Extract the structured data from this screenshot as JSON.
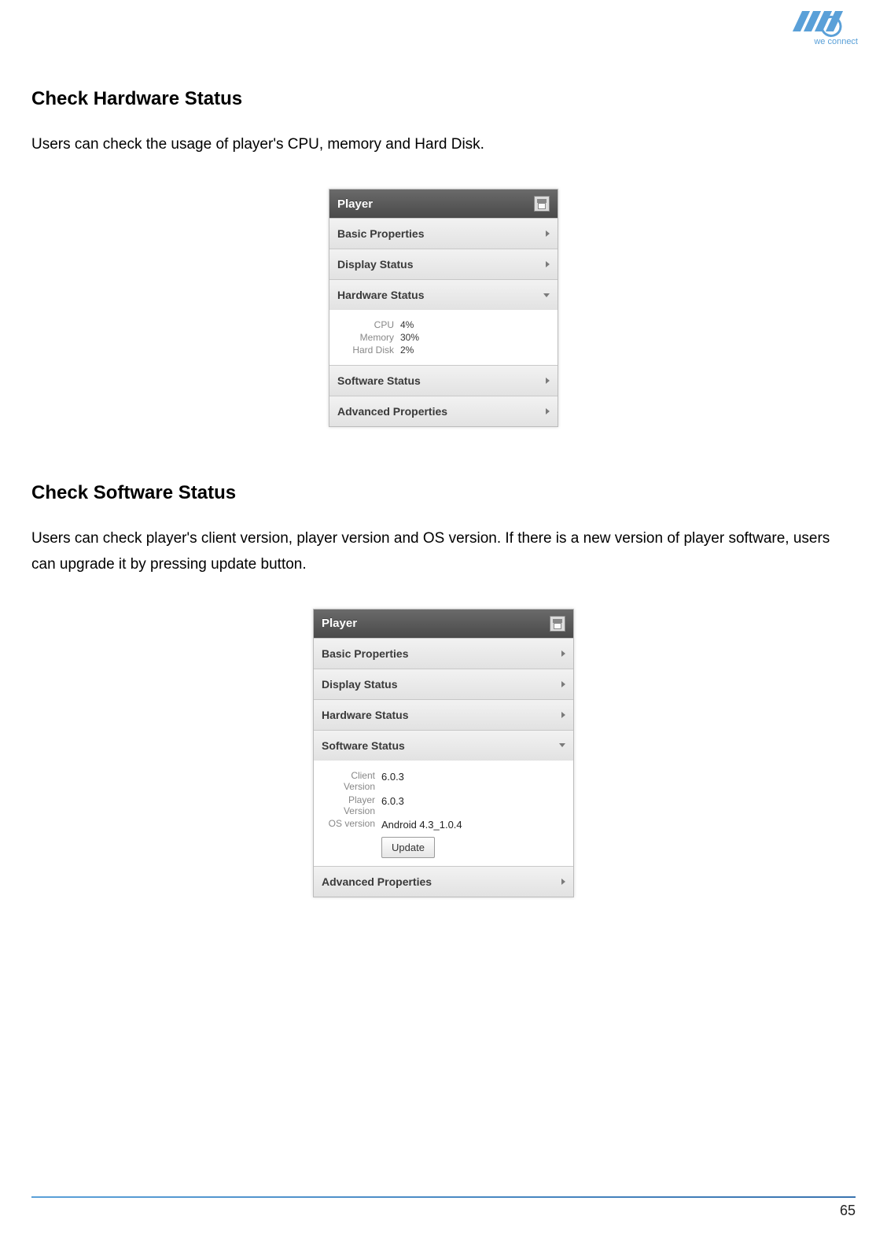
{
  "logo": {
    "tagline": "we connect"
  },
  "section1": {
    "title": "Check Hardware Status",
    "body": "Users can check the usage of player's CPU, memory and Hard Disk."
  },
  "section2": {
    "title": "Check Software Status",
    "body": "Users can check player's client version, player version and OS version. If there is a new version of player software, users can upgrade it by pressing update button."
  },
  "panel1": {
    "header": "Player",
    "items": {
      "basic": "Basic Properties",
      "display": "Display Status",
      "hardware": "Hardware Status",
      "software": "Software Status",
      "advanced": "Advanced Properties"
    },
    "hw": {
      "cpu_label": "CPU",
      "cpu_value": "4%",
      "mem_label": "Memory",
      "mem_value": "30%",
      "hd_label": "Hard Disk",
      "hd_value": "2%"
    }
  },
  "panel2": {
    "header": "Player",
    "items": {
      "basic": "Basic Properties",
      "display": "Display Status",
      "hardware": "Hardware Status",
      "software": "Software Status",
      "advanced": "Advanced Properties"
    },
    "sw": {
      "client_label": "Client Version",
      "client_value": "6.0.3",
      "player_label": "Player Version",
      "player_value": "6.0.3",
      "os_label": "OS version",
      "os_value": "Android 4.3_1.0.4",
      "update_label": "Update"
    }
  },
  "footer": {
    "page": "65"
  }
}
